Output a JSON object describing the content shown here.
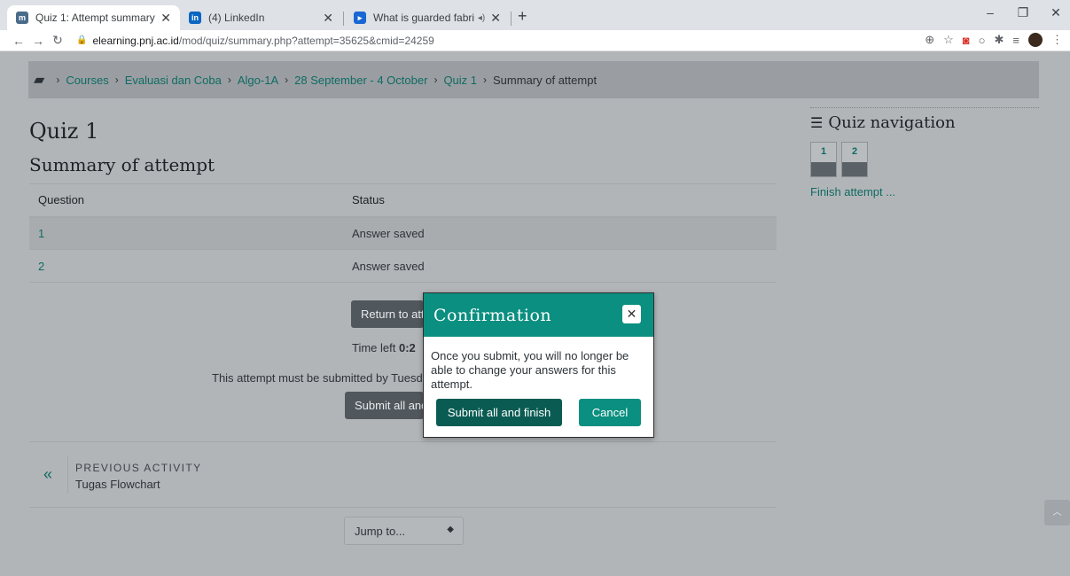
{
  "browser": {
    "tabs": [
      {
        "title": "Quiz 1: Attempt summary",
        "active": true,
        "favicon": "moodle-icon"
      },
      {
        "title": "(4) LinkedIn",
        "active": false,
        "favicon": "linkedin-icon"
      },
      {
        "title": "What is guarded fabric?",
        "active": false,
        "favicon": "video-icon"
      }
    ],
    "url_host": "elearning.pnj.ac.id",
    "url_path": "/mod/quiz/summary.php?attempt=35625&cmid=24259"
  },
  "breadcrumb": {
    "items": [
      "Courses",
      "Evaluasi dan Coba",
      "Algo-1A",
      "28 September - 4 October",
      "Quiz 1"
    ],
    "current": "Summary of attempt"
  },
  "main": {
    "quiz_title": "Quiz 1",
    "summary_title": "Summary of attempt",
    "table": {
      "headers": [
        "Question",
        "Status"
      ],
      "rows": [
        {
          "question": "1",
          "status": "Answer saved"
        },
        {
          "question": "2",
          "status": "Answer saved"
        }
      ]
    },
    "return_button": "Return to att",
    "time_left_label": "Time left",
    "time_left_value": "0:2",
    "submit_notice": "This attempt must be submitted by Tuesd",
    "submit_button": "Submit all and"
  },
  "activity": {
    "prev_label": "PREVIOUS ACTIVITY",
    "prev_name": "Tugas Flowchart"
  },
  "jumpto": {
    "label": "Jump to..."
  },
  "sidebar": {
    "title": "Quiz navigation",
    "questions": [
      "1",
      "2"
    ],
    "finish_link": "Finish attempt ..."
  },
  "modal": {
    "title": "Confirmation",
    "message": "Once you submit, you will no longer be able to change your answers for this attempt.",
    "submit_label": "Submit all and finish",
    "cancel_label": "Cancel"
  },
  "colors": {
    "accent": "#0b8f80",
    "accent_dark": "#0a5c53",
    "link": "#0f6b63"
  }
}
